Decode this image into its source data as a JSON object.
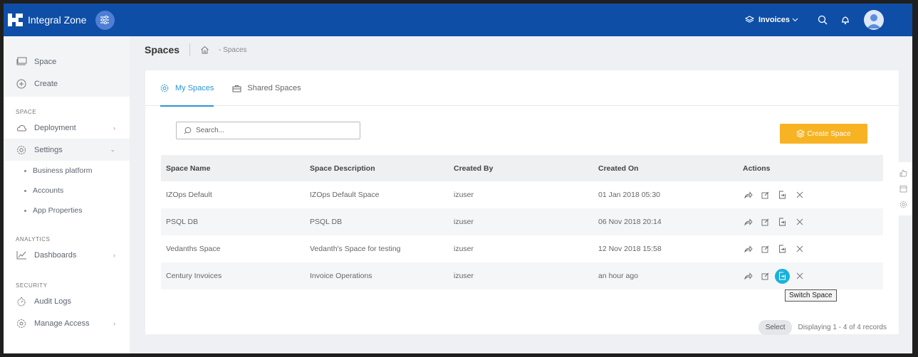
{
  "app": {
    "brand_name": "Integral Zone",
    "workspace_switch": "Invoices"
  },
  "sidebar": {
    "top_items": [
      {
        "label": "Space",
        "icon": "monitor-icon"
      },
      {
        "label": "Create",
        "icon": "plus-circle-icon"
      }
    ],
    "sections": {
      "space": "SPACE",
      "analytics": "ANALYTICS",
      "security": "SECURITY"
    },
    "space_items": {
      "deployment": "Deployment",
      "settings": "Settings",
      "sub": [
        "Business platform",
        "Accounts",
        "App Properties"
      ]
    },
    "analytics_items": {
      "dashboards": "Dashboards"
    },
    "security_items": {
      "audit_logs": "Audit Logs",
      "manage_access": "Manage Access"
    }
  },
  "header": {
    "title": "Spaces",
    "breadcrumb": "- Spaces"
  },
  "tabs": [
    {
      "label": "My Spaces",
      "active": true,
      "icon": "gear-icon"
    },
    {
      "label": "Shared Spaces",
      "active": false,
      "icon": "briefcase-icon"
    }
  ],
  "search": {
    "placeholder": "Search..."
  },
  "create_button": {
    "label": "Create Space"
  },
  "table": {
    "columns": [
      "Space Name",
      "Space Description",
      "Created By",
      "Created On",
      "Actions"
    ],
    "rows": [
      {
        "name": "IZOps Default",
        "description": "IZOps Default Space",
        "created_by": "izuser",
        "created_on": "01 Jan 2018 05:30"
      },
      {
        "name": "PSQL DB",
        "description": "PSQL DB",
        "created_by": "izuser",
        "created_on": "06 Nov 2018 20:14"
      },
      {
        "name": "Vedanths Space",
        "description": "Vedanth's Space for testing",
        "created_by": "izuser",
        "created_on": "12 Nov 2018 15:58"
      },
      {
        "name": "Century Invoices",
        "description": "Invoice Operations",
        "created_by": "izuser",
        "created_on": "an hour ago"
      }
    ]
  },
  "tooltip": "Switch Space",
  "footer": {
    "select_label": "Select",
    "records": "Displaying 1 - 4 of 4 records"
  },
  "colors": {
    "topbar": "#0e4ea6",
    "accent": "#2a96d8",
    "create_button": "#f7b324",
    "switch_highlight": "#1ab2dc"
  }
}
